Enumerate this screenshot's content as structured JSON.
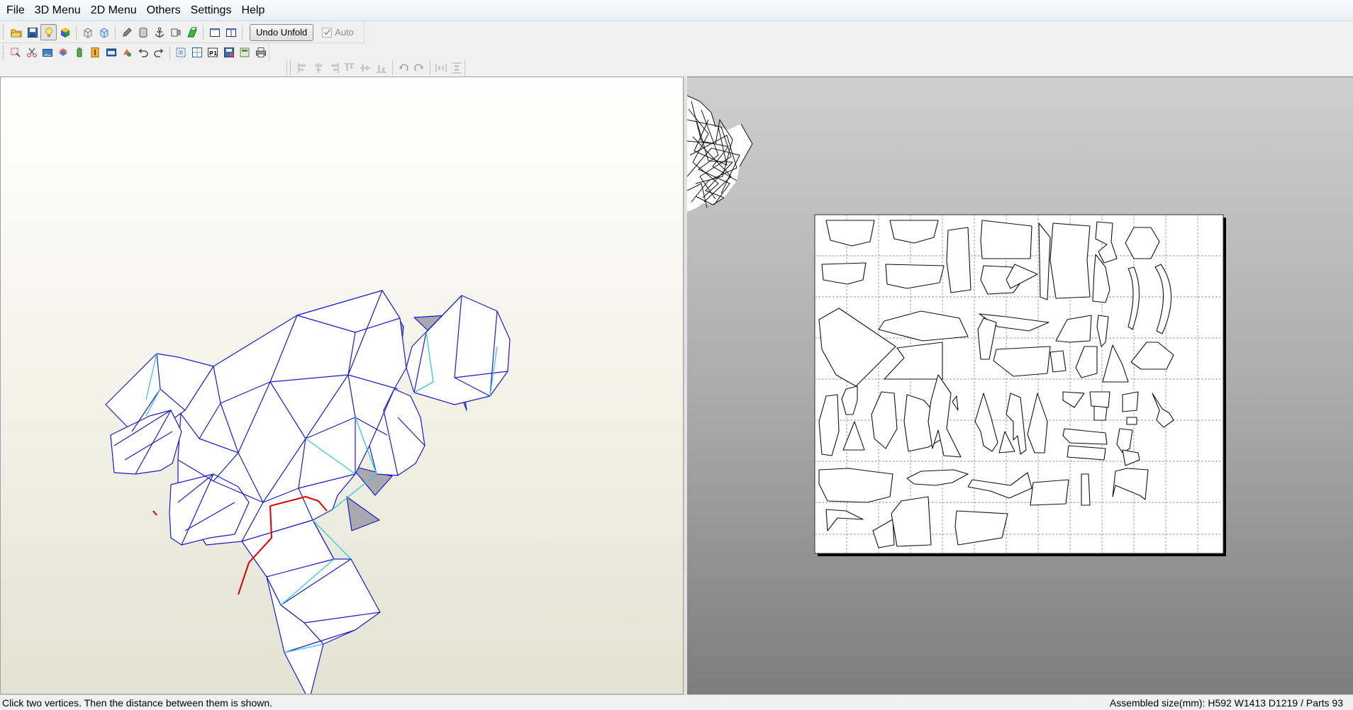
{
  "menubar": {
    "items": [
      "File",
      "3D Menu",
      "2D Menu",
      "Others",
      "Settings",
      "Help"
    ]
  },
  "toolbar": {
    "undo_unfold_label": "Undo Unfold",
    "auto_label": "Auto",
    "auto_checked": true
  },
  "icons": {
    "toolbar_1": [
      "open-folder-icon",
      "save-disk-icon",
      "light-bulb-icon",
      "color-cube-icon",
      "wire-cube-icon",
      "paper-cube-icon",
      "pencil-icon",
      "cylinder-icon",
      "anchor-icon",
      "box-join-icon",
      "green-flap-icon",
      "single-view-icon",
      "dual-view-icon"
    ],
    "toolbar_2": [
      "select-edge-icon",
      "scissor-icon",
      "image-icon",
      "stripes-icon",
      "green-bottle-icon",
      "orange-i-icon",
      "blue-window-icon",
      "rotate-part-icon",
      "undo-icon",
      "redo-icon",
      "arrange-icon",
      "page-grid-icon",
      "page-number-icon",
      "save-layout-icon",
      "texture-icon",
      "print-icon"
    ],
    "toolbar_3": [
      "align-left-icon",
      "align-center-icon",
      "align-right-icon",
      "align-top-icon",
      "align-middle-icon",
      "align-bottom-icon",
      "rotate-ccw-icon",
      "rotate-cw-icon",
      "distribute-h-icon",
      "distribute-v-icon"
    ]
  },
  "statusbar": {
    "hint": "Click two vertices. Then the distance between them is shown.",
    "assembled": "Assembled size(mm): H592 W1413 D1219 / Parts 93"
  },
  "colors": {
    "wire_blue": "#1a1acc",
    "fold_cyan": "#33ccdd",
    "cut_red": "#dd0000",
    "shade_gray": "#a8a8ae",
    "paper_white": "#ffffff"
  }
}
